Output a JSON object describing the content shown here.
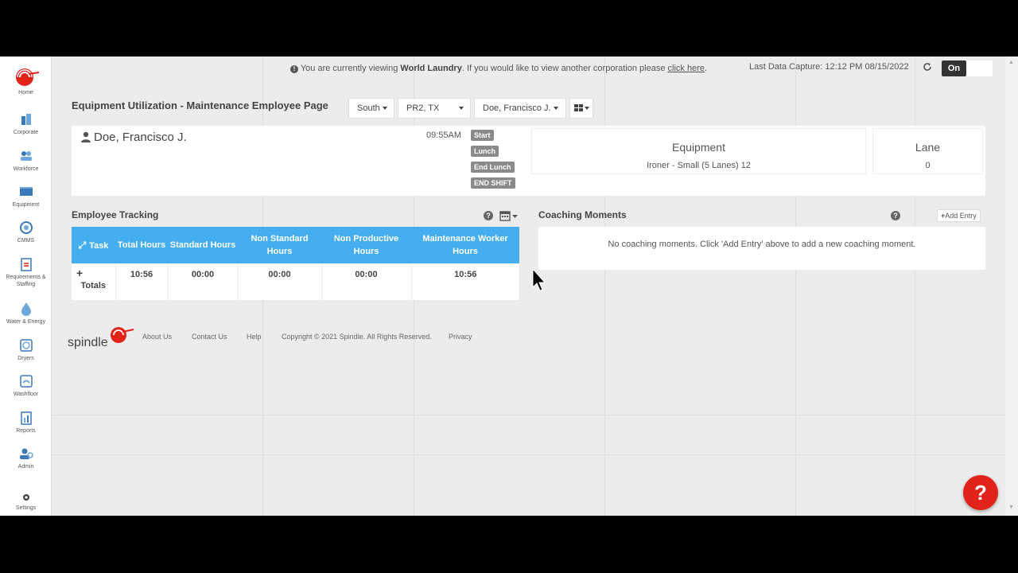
{
  "sidebar": {
    "home": "Home",
    "items": [
      {
        "label": "Corporate",
        "icon": "building-icon"
      },
      {
        "label": "Workforce",
        "icon": "people-icon"
      },
      {
        "label": "Equipment",
        "icon": "washer-icon"
      },
      {
        "label": "CMMS",
        "icon": "target-icon"
      },
      {
        "label": "Requirements & Staffing",
        "icon": "clipboard-icon"
      },
      {
        "label": "Water & Energy",
        "icon": "water-drop-icon"
      },
      {
        "label": "Dryers",
        "icon": "dryer-icon"
      },
      {
        "label": "Washfloor",
        "icon": "washfloor-icon"
      },
      {
        "label": "Reports",
        "icon": "reports-icon"
      },
      {
        "label": "Admin",
        "icon": "admin-icon"
      },
      {
        "label": "Settings",
        "icon": "gear-icon"
      }
    ]
  },
  "notice": {
    "prefix": "You are currently viewing",
    "corp": "World Laundry",
    "suffix": ". If you would like to view another corporation please",
    "link": "click here",
    "end": "."
  },
  "capture": "Last Data Capture: 12:12 PM 08/15/2022",
  "toggle": {
    "on_label": "On"
  },
  "page": {
    "title": "Equipment Utilization - Maintenance Employee Page"
  },
  "filters": {
    "region": "South",
    "plant": "PR2, TX",
    "employee": "Doe, Francisco J."
  },
  "employee": {
    "name": "Doe, Francisco J.",
    "time": "09:55AM",
    "events": [
      "Start",
      "Lunch",
      "End Lunch",
      "END SHIFT"
    ],
    "equipment_label": "Equipment",
    "equipment_value": "Ironer - Small (5 Lanes) 12",
    "lane_label": "Lane",
    "lane_value": "0"
  },
  "tracking": {
    "title": "Employee Tracking",
    "headers": [
      "Task",
      "Total Hours",
      "Standard Hours",
      "Non Standard Hours",
      "Non Productive Hours",
      "Maintenance Worker Hours"
    ],
    "totals_label": "Totals",
    "totals": [
      "10:56",
      "00:00",
      "00:00",
      "00:00",
      "10:56"
    ]
  },
  "coaching": {
    "title": "Coaching Moments",
    "add_label": "Add Entry",
    "empty_msg": "No coaching moments.  Click 'Add Entry' above to add a new coaching moment."
  },
  "footer": {
    "logo_text": "spindle",
    "links": [
      "About Us",
      "Contact Us",
      "Help"
    ],
    "copyright": "Copyright © 2021 Spindle. All Rights Reserved.",
    "privacy": "Privacy"
  },
  "help_fab": "?",
  "colors": {
    "accent": "#45aef0",
    "brand": "#e2231a",
    "event_badge": "#8a8a8a"
  }
}
